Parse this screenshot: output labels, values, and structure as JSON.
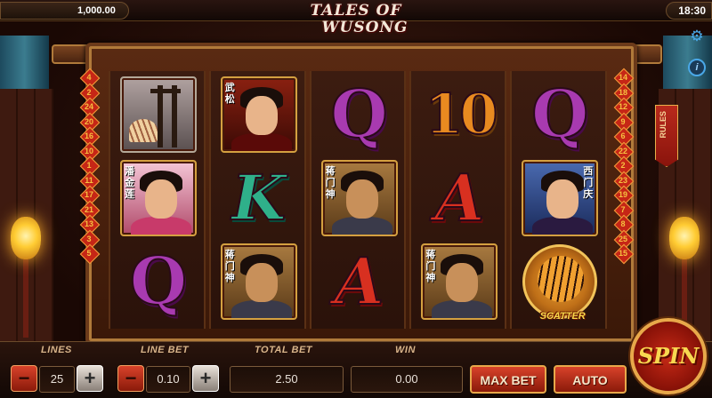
{
  "header": {
    "balance": "1,000.00",
    "clock": "18:30",
    "logo_line1": "TALES OF",
    "logo_line2": "WUSONG"
  },
  "side": {
    "rules_label": "RULES",
    "gear_icon": "gear-icon",
    "info_icon": "info-icon"
  },
  "paylines_left": [
    "4",
    "2",
    "24",
    "20",
    "16",
    "10",
    "1",
    "11",
    "17",
    "21",
    "13",
    "3",
    "5"
  ],
  "paylines_right": [
    "14",
    "18",
    "12",
    "9",
    "6",
    "22",
    "2",
    "23",
    "19",
    "7",
    "8",
    "25",
    "15"
  ],
  "reels": [
    [
      {
        "type": "portrait",
        "variant": "weapon",
        "glyph": ""
      },
      {
        "type": "portrait",
        "variant": "jinlian",
        "glyph": "潘金莲"
      },
      {
        "type": "letter",
        "symbol": "Q"
      }
    ],
    [
      {
        "type": "portrait",
        "variant": "wusong",
        "glyph": "武松"
      },
      {
        "type": "letter",
        "symbol": "K"
      },
      {
        "type": "portrait",
        "variant": "doorgod",
        "glyph": "蒋门神"
      }
    ],
    [
      {
        "type": "letter",
        "symbol": "Q"
      },
      {
        "type": "portrait",
        "variant": "doorgod",
        "glyph": "蒋门神"
      },
      {
        "type": "letter",
        "symbol": "A"
      }
    ],
    [
      {
        "type": "letter",
        "symbol": "10"
      },
      {
        "type": "letter",
        "symbol": "A"
      },
      {
        "type": "portrait",
        "variant": "doorgod",
        "glyph": "蒋门神"
      }
    ],
    [
      {
        "type": "letter",
        "symbol": "Q"
      },
      {
        "type": "portrait",
        "variant": "ximen",
        "glyph": "西门庆"
      },
      {
        "type": "scatter",
        "label": "SCATTER"
      }
    ]
  ],
  "controls": {
    "lines_label": "LINES",
    "lines_value": "25",
    "line_bet_label": "LINE BET",
    "line_bet_value": "0.10",
    "total_bet_label": "TOTAL BET",
    "total_bet_value": "2.50",
    "win_label": "WIN",
    "win_value": "0.00",
    "max_bet_label": "MAX BET",
    "auto_label": "AUTO",
    "spin_label": "SPIN",
    "minus_glyph": "−",
    "plus_glyph": "+"
  },
  "colors": {
    "accent_red": "#c62616",
    "gold": "#e8a84a",
    "q_purple": "#a83ab0",
    "k_green": "#2fb08a",
    "a_red": "#d83020",
    "ten_orange": "#e88a20"
  }
}
